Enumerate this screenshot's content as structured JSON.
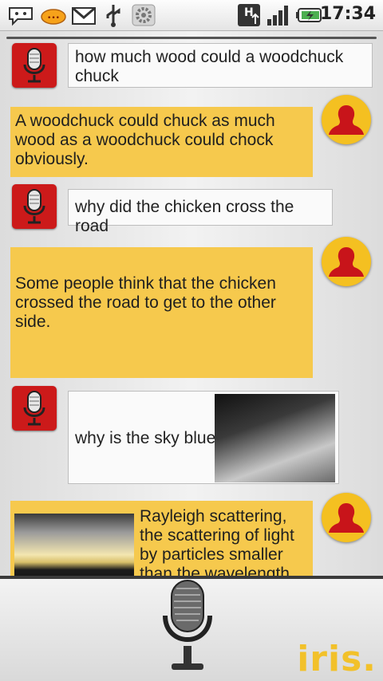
{
  "status_bar": {
    "time": "17:34",
    "icons": [
      "chat-icon",
      "email-icon",
      "gmail-icon",
      "usb-icon",
      "settings-icon",
      "hspa-icon",
      "signal-icon",
      "battery-icon"
    ],
    "network_label": "H"
  },
  "conversation": [
    {
      "role": "user",
      "text": "how much wood could a woodchuck chuck"
    },
    {
      "role": "iris",
      "text": "A woodchuck could chuck as much wood as a woodchuck could chock obviously."
    },
    {
      "role": "user",
      "text": "why did the chicken cross the road"
    },
    {
      "role": "iris",
      "text": "Some people think that the chicken crossed the road to get to the other side."
    },
    {
      "role": "user",
      "text": "why is the sky blue"
    },
    {
      "role": "iris",
      "text": "Rayleigh scattering, the scattering of light by particles smaller than the wavelength"
    }
  ],
  "brand": "iris.",
  "colors": {
    "accent": "#f6c94d",
    "user_avatar": "#cc1a1a",
    "iris_avatar": "#f4c021"
  }
}
